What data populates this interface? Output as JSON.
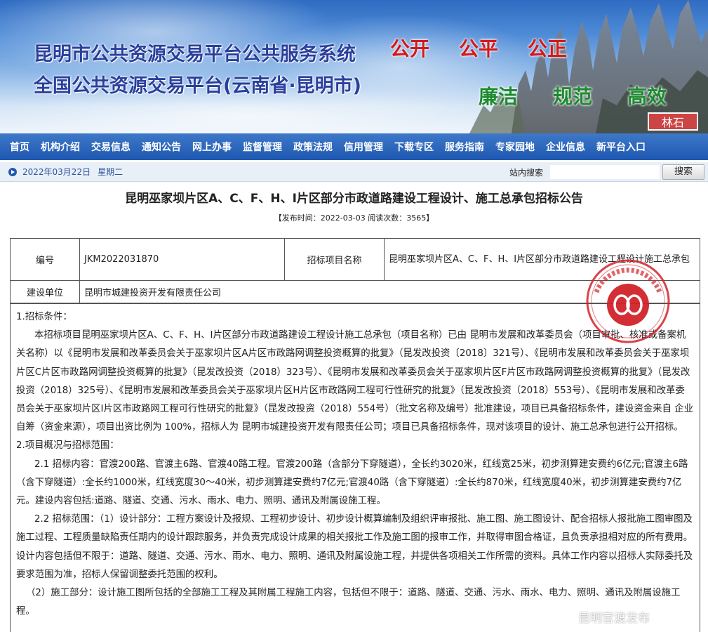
{
  "banner": {
    "title_line1": "昆明市公共资源交易平台公共服务系统",
    "title_line2": "全国公共资源交易平台(云南省·昆明市)",
    "slogan_red": [
      "公开",
      "公平",
      "公正"
    ],
    "slogan_green": [
      "廉洁",
      "规范",
      "高效"
    ],
    "corner_mark": "林石"
  },
  "nav": [
    "首页",
    "机构介绍",
    "交易信息",
    "通知公告",
    "网上办事",
    "监督管理",
    "政策法规",
    "信用管理",
    "下载专区",
    "服务指南",
    "专家园地",
    "企业信息",
    "新平台入口"
  ],
  "datebar": {
    "date": "2022年03月22日",
    "weekday": "星期二",
    "search_label": "站内搜索",
    "search_value": "",
    "search_button": "搜索"
  },
  "article": {
    "title": "昆明巫家坝片区A、C、F、H、I片区部分市政道路建设工程设计、施工总承包招标公告",
    "meta": "【发布时间：2022-03-03 阅读次数：3565】"
  },
  "info_table": {
    "row1": {
      "label1": "编号",
      "value1": "JKM2022031870",
      "label2": "招标项目名称",
      "value2": "昆明巫家坝片区A、C、F、H、I片区部分市政道路建设工程设计施工总承包"
    },
    "row2": {
      "label": "建设单位",
      "value": "昆明市城建投资开发有限责任公司"
    }
  },
  "body": {
    "s1_heading": "1.招标条件：",
    "s1_p1": "本招标项目昆明巫家坝片区A、C、F、H、I片区部分市政道路建设工程设计施工总承包（项目名称）已由 昆明市发展和改革委员会（项目审批、核准或备案机关名称）以《昆明市发展和改革委员会关于巫家坝片区A片区市政路网调整投资概算的批复》（昆发改投资〔2018〕321号）、《昆明市发展和改革委员会关于巫家坝片区C片区市政路网调整投资概算的批复》（昆发改投资（2018）323号）、《昆明市发展和改革委员会关于巫家坝片区F片区市政路网调整投资概算的批复》（昆发改投资（2018）325号）、《昆明市发展和改革委员会关于巫家坝片区H片区市政路网工程可行性研究的批复》（昆发改投资（2018）553号）、《昆明市发展和改革委员会关于巫家坝片区I片区市政路网工程可行性研究的批复》（昆发改投资（2018）554号）（批文名称及编号）批准建设，项目已具备招标条件，建设资金来自 企业自筹（资金来源），项目出资比例为 100%，招标人为 昆明市城建投资开发有限责任公司；项目已具备招标条件，现对该项目的设计、施工总承包进行公开招标。",
    "s2_heading": "2.项目概况与招标范围：",
    "s2_p1": "2.1 招标内容：官渡200路、官渡主6路、官渡40路工程。官渡200路（含部分下穿隧道），全长约3020米，红线宽25米，初步测算建安费约6亿元;官渡主6路（含下穿隧道）:全长约1000米，红线宽度30～40米，初步测算建安费约7亿元;官渡40路（含下穿隧道）:全长约870米，红线宽度40米，初步测算建安费约7亿元。建设内容包括:道路、隧道、交通、污水、雨水、电力、照明、通讯及附属设施工程。",
    "s2_p2": "2.2 招标范围：（1）设计部分：工程方案设计及报规、工程初步设计、初步设计概算编制及组织评审报批、施工图、施工图设计、配合招标人报批施工图审图及施工过程、工程质量缺陷责任期内的设计跟踪服务，并负责完成设计成果的相关报批工作及施工图的报审工作，并取得审图合格证，且负责承担相对应的所有费用。设计内容包括但不限于：道路、隧道、交通、污水、雨水、电力、照明、通讯及附属设施工程，并提供各项相关工作所需的资料。具体工作内容以招标人实际委托及要求范围为准，招标人保留调整委托范围的权利。",
    "s2_p3": "（2）施工部分：设计施工图所包括的全部施工工程及其附属工程施工内容，包括但不限于：道路、隧道、交通、污水、雨水、电力、照明、通讯及附属设施工程。"
  },
  "stamp_text": "公共资源交易中心专用章",
  "watermark": "昆明官渡发布",
  "colors": {
    "nav_bg": "#1f58b0",
    "title_blue": "#2a3f9c",
    "slogan_red": "#d4181b",
    "slogan_green": "#1d8a2f",
    "stamp_red": "#d2232a"
  }
}
